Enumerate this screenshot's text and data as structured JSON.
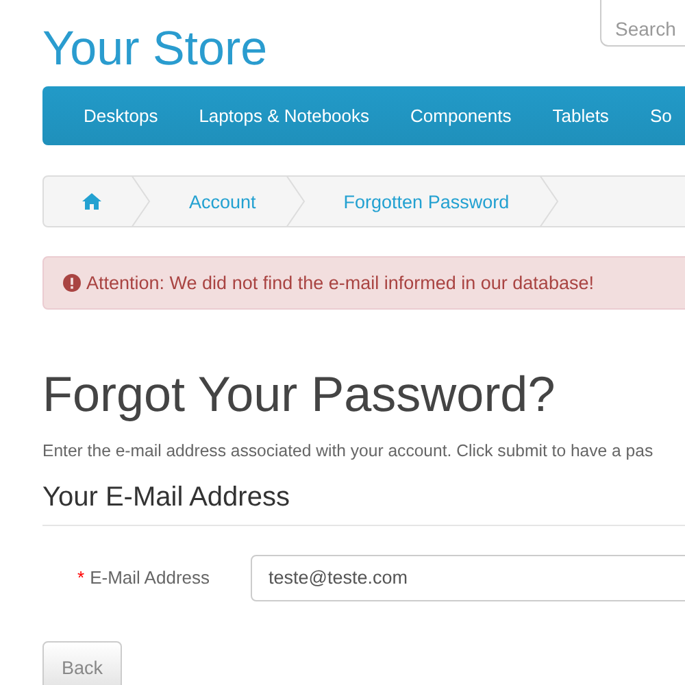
{
  "header": {
    "logo": "Your Store",
    "search": {
      "placeholder": "Search"
    }
  },
  "menu": [
    {
      "label": "Desktops"
    },
    {
      "label": "Laptops & Notebooks"
    },
    {
      "label": "Components"
    },
    {
      "label": "Tablets"
    },
    {
      "label": "So"
    }
  ],
  "breadcrumb": [
    {
      "kind": "home"
    },
    {
      "kind": "link",
      "label": "Account"
    },
    {
      "kind": "link",
      "label": "Forgotten Password"
    }
  ],
  "alert": {
    "text": "Attention: We did not find the e-mail informed in our database!"
  },
  "title": "Forgot Your Password?",
  "intro": "Enter the e-mail address associated with your account. Click submit to have a pas",
  "section": "Your E-Mail Address",
  "field": {
    "required_mark": "*",
    "label": "E-Mail Address",
    "value": "teste@teste.com"
  },
  "buttons": [
    {
      "label": "Back"
    }
  ]
}
